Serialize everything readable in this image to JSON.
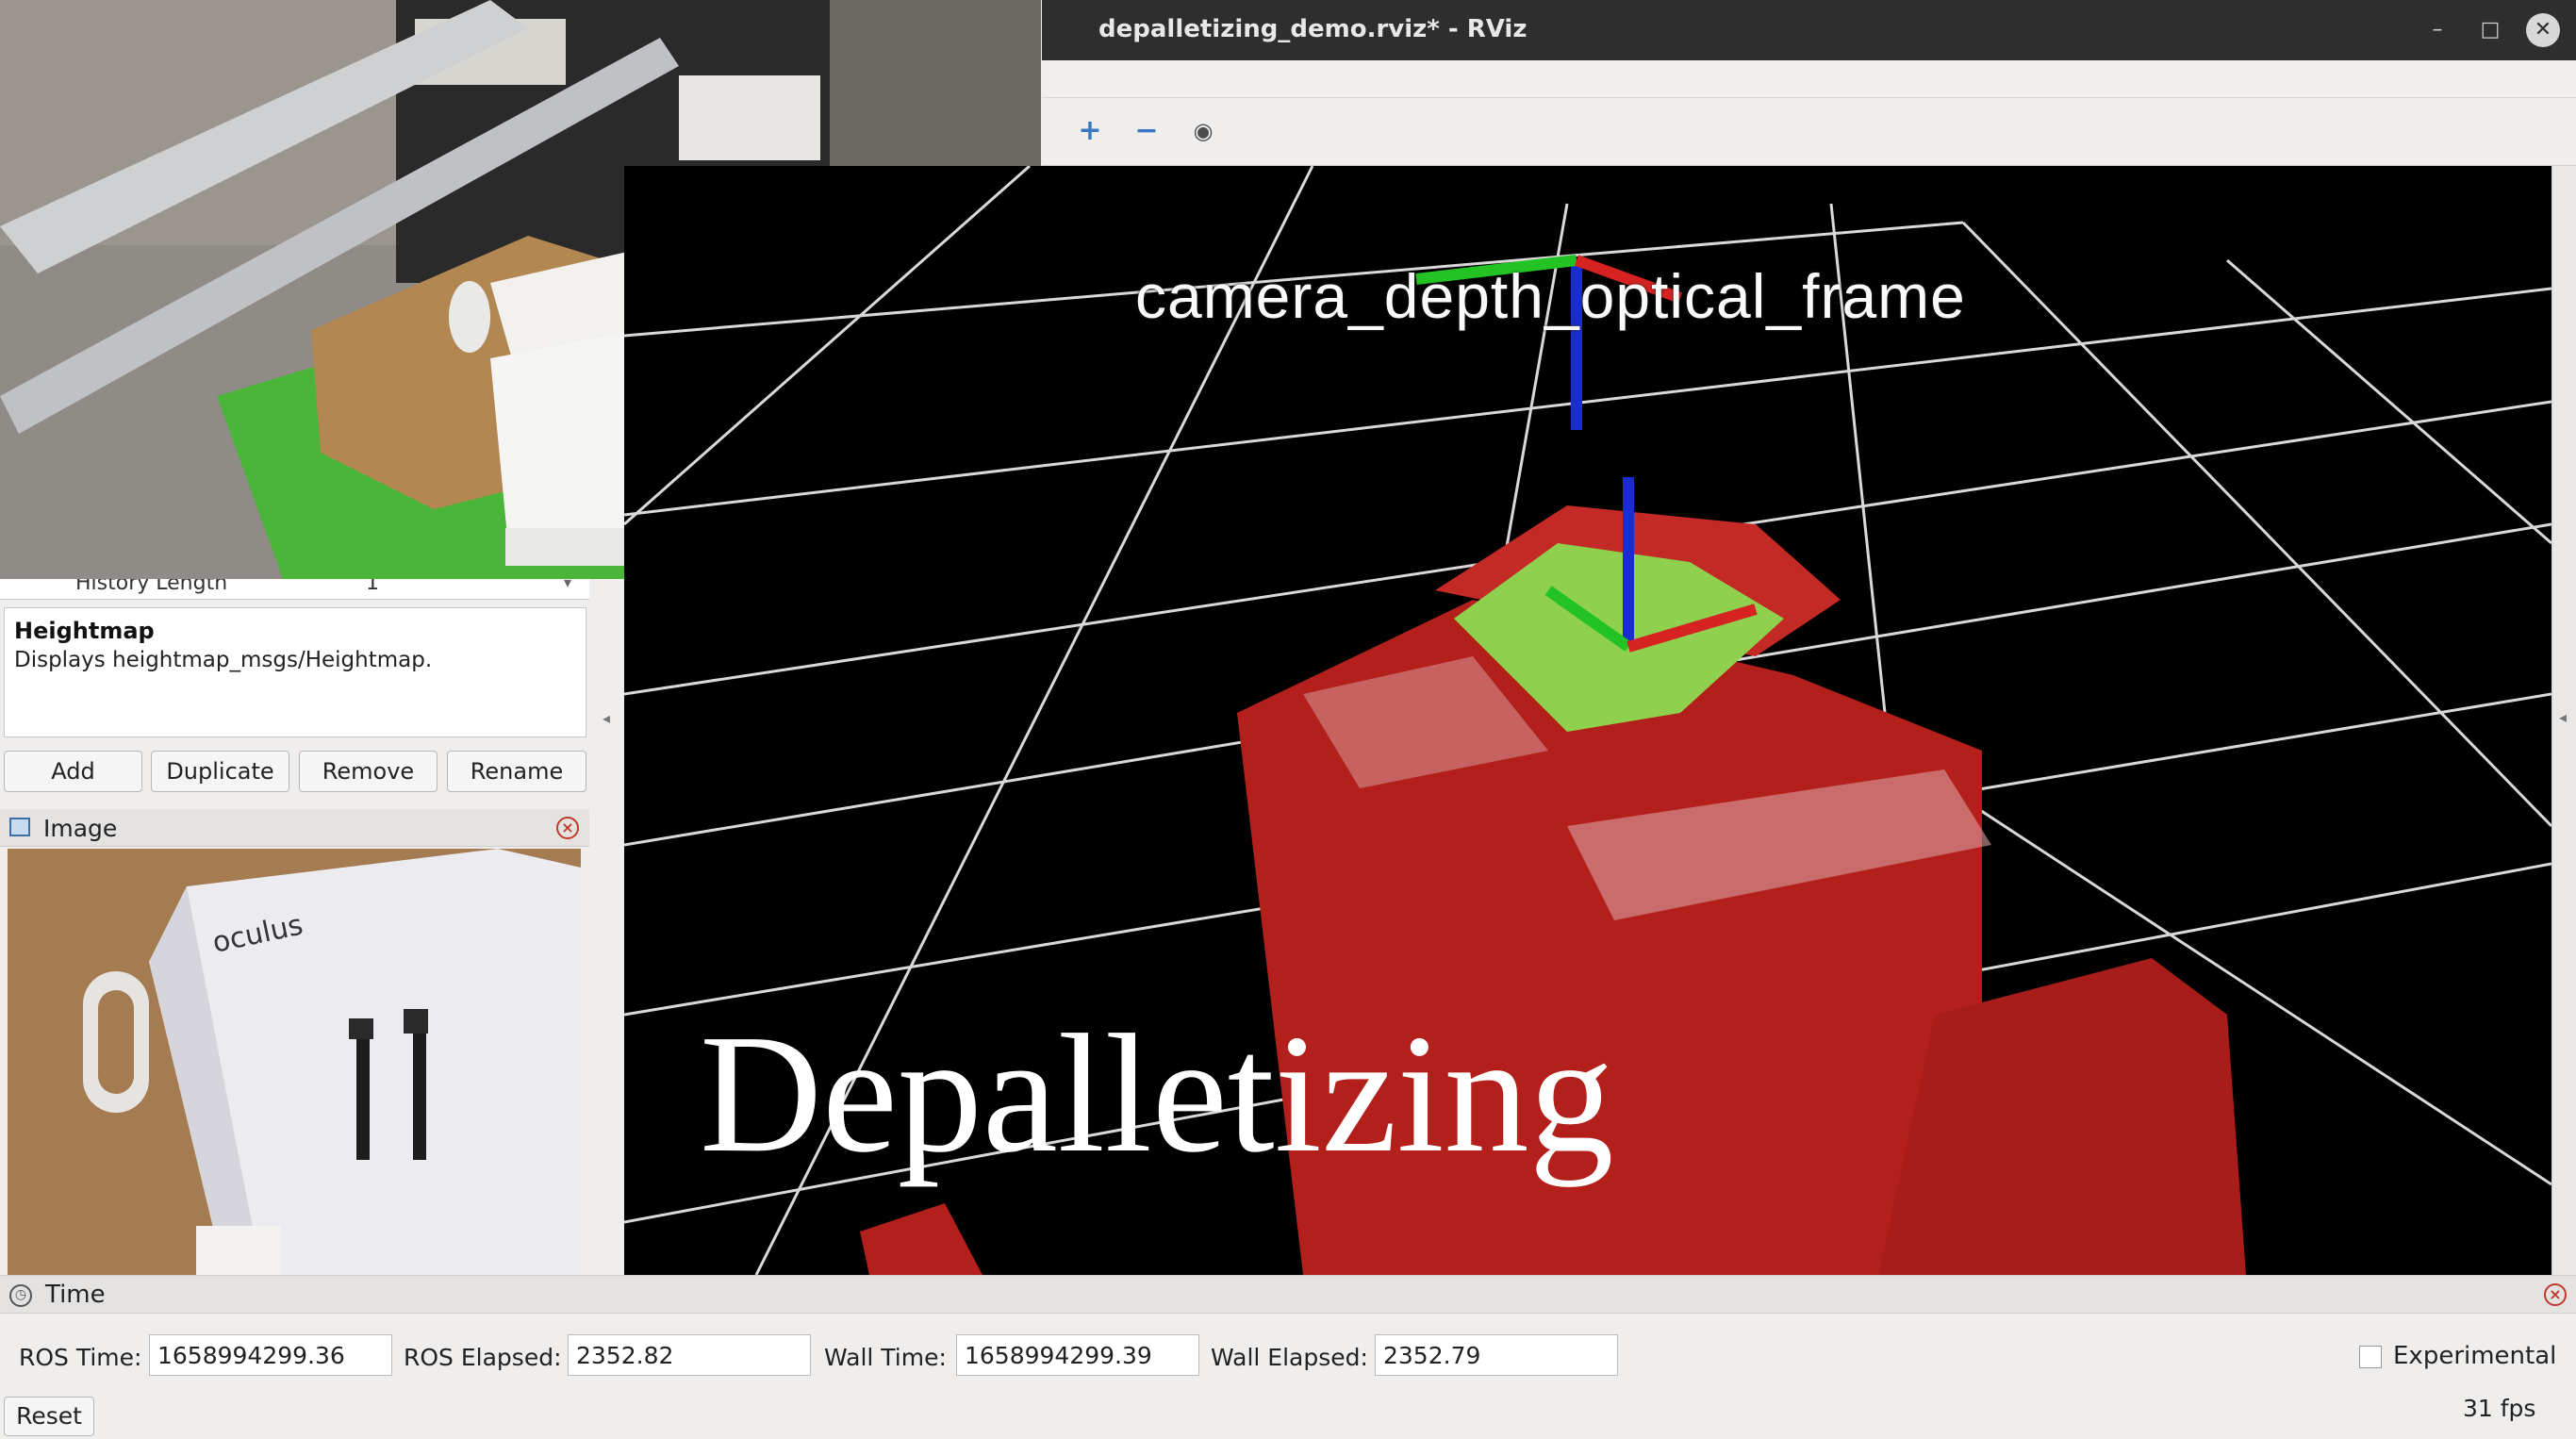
{
  "window": {
    "title": "depalletizing_demo.rviz* - RViz",
    "minimize": "–",
    "maximize": "□",
    "close": "✕"
  },
  "toolbar": {
    "zoom_in": "+",
    "zoom_out": "−",
    "eye": "◉"
  },
  "viewport": {
    "frame_label": "camera_depth_optical_frame",
    "overlay_text": "Depalletizing"
  },
  "displays_panel": {
    "property_key": "History Length",
    "property_value": "1",
    "description_title": "Heightmap",
    "description_text": "Displays heightmap_msgs/Heightmap.",
    "buttons": {
      "add": "Add",
      "duplicate": "Duplicate",
      "remove": "Remove",
      "rename": "Rename"
    }
  },
  "image_panel": {
    "title": "Image"
  },
  "time_panel": {
    "title": "Time",
    "ros_time_label": "ROS Time:",
    "ros_time": "1658994299.36",
    "ros_elapsed_label": "ROS Elapsed:",
    "ros_elapsed": "2352.82",
    "wall_time_label": "Wall Time:",
    "wall_time": "1658994299.39",
    "wall_elapsed_label": "Wall Elapsed:",
    "wall_elapsed": "2352.79",
    "experimental_label": "Experimental",
    "reset_label": "Reset",
    "fps": "31 fps"
  }
}
